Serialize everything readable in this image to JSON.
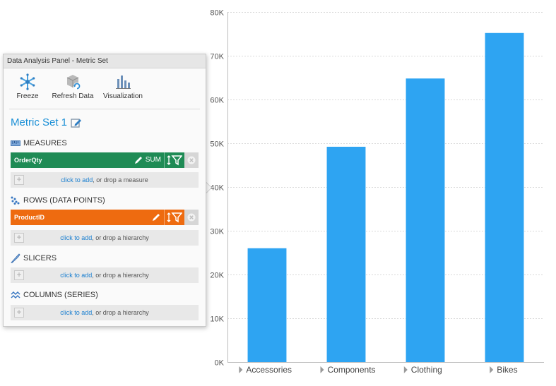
{
  "panel": {
    "title": "Data Analysis Panel - Metric Set",
    "toolbar": [
      {
        "label": "Freeze",
        "icon": "snowflake-icon"
      },
      {
        "label": "Refresh Data",
        "icon": "refresh-data-icon"
      },
      {
        "label": "Visualization",
        "icon": "bar-chart-icon"
      }
    ],
    "metric_set_title": "Metric Set 1",
    "sections": {
      "measures": {
        "label": "MEASURES",
        "item": {
          "name": "OrderQty",
          "aggregation": "SUM",
          "color": "#1f8b55"
        },
        "drop_link": "click to add",
        "drop_text": ", or drop a measure"
      },
      "rows": {
        "label": "ROWS (DATA POINTS)",
        "item": {
          "name": "ProductID",
          "color": "#ee6b10"
        },
        "drop_link": "click to add",
        "drop_text": ", or drop a hierarchy"
      },
      "slicers": {
        "label": "SLICERS",
        "drop_link": "click to add",
        "drop_text": ", or drop a hierarchy"
      },
      "columns": {
        "label": "COLUMNS (SERIES)",
        "drop_link": "click to add",
        "drop_text": ", or drop a hierarchy"
      }
    }
  },
  "chart_data": {
    "type": "bar",
    "categories": [
      "Accessories",
      "Components",
      "Clothing",
      "Bikes"
    ],
    "values": [
      26000,
      49200,
      64800,
      75200
    ],
    "ylim": [
      0,
      80000
    ],
    "yticks": [
      0,
      10000,
      20000,
      30000,
      40000,
      50000,
      60000,
      70000,
      80000
    ],
    "ytick_labels": [
      "0K",
      "10K",
      "20K",
      "30K",
      "40K",
      "50K",
      "60K",
      "70K",
      "80K"
    ],
    "title": "",
    "xlabel": "",
    "ylabel": "",
    "grid": true,
    "bar_color": "#2ea4f2"
  }
}
